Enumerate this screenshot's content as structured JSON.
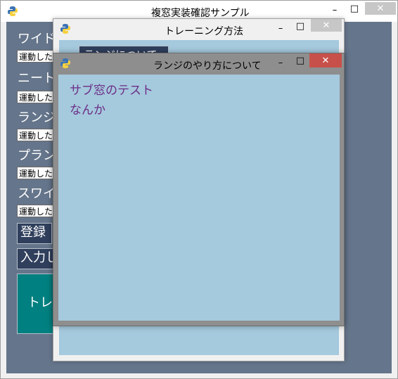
{
  "main_window": {
    "title": "複窓実装確認サンプル",
    "controls": {
      "minimize": "–",
      "maximize": "□",
      "close": "✕"
    },
    "labels": [
      "ワイド",
      "ニート",
      "ランジ",
      "プラン",
      "スワイ"
    ],
    "entries": [
      "運動した",
      "運動した",
      "運動した",
      "運動した",
      "運動した"
    ],
    "register_button": "登録",
    "input_button": "入力し",
    "training_button": "トレー"
  },
  "training_window": {
    "title": "トレーニング方法",
    "controls": {
      "minimize": "–",
      "maximize": "□",
      "close": "✕"
    },
    "button_partial": "ランジについて"
  },
  "lunge_window": {
    "title": "ランジのやり方について",
    "controls": {
      "minimize": "–",
      "maximize": "□",
      "close": "✕"
    },
    "lines": [
      "サブ窓のテスト",
      "なんか"
    ]
  },
  "colors": {
    "main_bg": "#65758b",
    "sub_bg": "#a5c9dd",
    "text_purple": "#6b2e86",
    "button_dark": "#2f3f5c",
    "teal": "#008080",
    "close_red": "#c7504a"
  }
}
